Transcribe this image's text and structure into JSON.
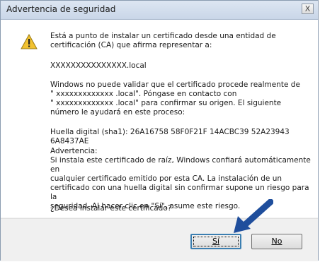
{
  "window": {
    "title": "Advertencia de seguridad",
    "close_glyph": "X"
  },
  "message": {
    "intro_line1": "Está a punto de instalar un certificado desde una entidad de",
    "intro_line2": "certificación (CA) que afirma representar a:",
    "domain": "XXXXXXXXXXXXXXX.local",
    "validate_line1": "Windows no puede validar que el certificado procede realmente de",
    "validate_line2": "\" xxxxxxxxxxxxx .local\". Póngase en contacto con",
    "validate_line3": "\" xxxxxxxxxxxxx .local\" para confirmar su origen. El siguiente",
    "validate_line4": "número le ayudará en este proceso:",
    "thumbprint": "Huella digital (sha1): 26A16758 58F0F21F 14ACBC39 52A23943 6A8437AE",
    "warning_heading": "Advertencia:",
    "warning_line1": "Si instala este certificado de raíz, Windows confiará automáticamente en",
    "warning_line2": "cualquier certificado emitido por esta CA. La instalación de un",
    "warning_line3": "certificado con una huella digital sin confirmar supone un riesgo para la",
    "warning_line4": "seguridad. Al hacer clic en \"Sí\", asume este riesgo.",
    "question": "¿Desea instalar este certificado?"
  },
  "buttons": {
    "yes_label": "Sí",
    "no_label": "No"
  },
  "icons": {
    "warning": "warning-triangle-icon",
    "annotation_arrow": "arrow-icon"
  },
  "colors": {
    "arrow": "#1f4e9c",
    "warning_fill": "#f2c230"
  }
}
